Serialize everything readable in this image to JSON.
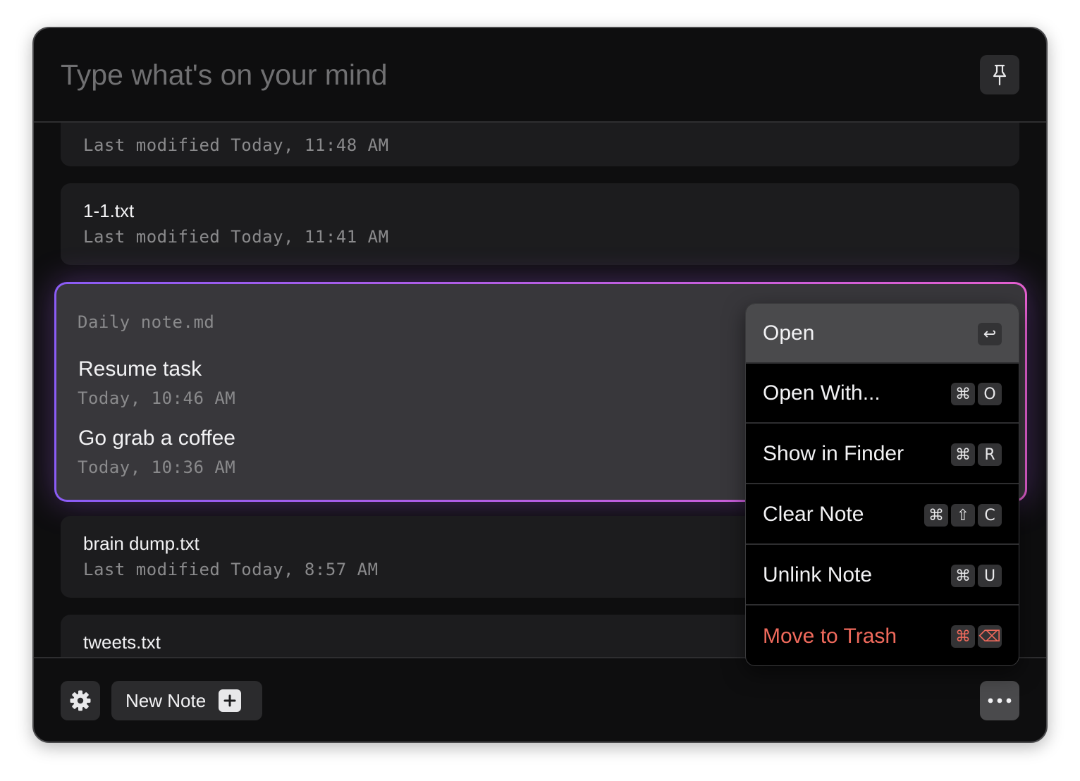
{
  "search": {
    "placeholder": "Type what's on your mind"
  },
  "notes": [
    {
      "title": "",
      "meta": "Last modified Today, 11:48 AM"
    },
    {
      "title": "1-1.txt",
      "meta": "Last modified Today, 11:41 AM"
    },
    {
      "title": "brain dump.txt",
      "meta": "Last modified Today, 8:57 AM"
    },
    {
      "title": "tweets.txt",
      "meta": ""
    }
  ],
  "selected": {
    "filename": "Daily note.md",
    "entries": [
      {
        "title": "Resume task",
        "time": "Today, 10:46 AM"
      },
      {
        "title": "Go grab a coffee",
        "time": "Today, 10:36 AM"
      }
    ]
  },
  "menu": {
    "items": [
      {
        "label": "Open",
        "keys": [
          "↩"
        ],
        "highlighted": true
      },
      {
        "label": "Open With...",
        "keys": [
          "⌘",
          "O"
        ]
      },
      {
        "label": "Show in Finder",
        "keys": [
          "⌘",
          "R"
        ]
      },
      {
        "label": "Clear Note",
        "keys": [
          "⌘",
          "⇧",
          "C"
        ]
      },
      {
        "label": "Unlink Note",
        "keys": [
          "⌘",
          "U"
        ]
      },
      {
        "label": "Move to Trash",
        "keys": [
          "⌘",
          "⌫"
        ],
        "danger": true
      }
    ]
  },
  "footer": {
    "new_note_label": "New Note"
  },
  "colors": {
    "accent_start": "#8b5cf6",
    "accent_end": "#e35fcf",
    "danger": "#f06a5c",
    "window_bg": "#0e0e0f"
  },
  "icons": {
    "pin": "pin-icon",
    "settings": "gear-icon",
    "new_note_plus": "plus-icon",
    "more": "more-dots-icon",
    "enter": "return-key-icon",
    "delete": "delete-key-icon"
  }
}
